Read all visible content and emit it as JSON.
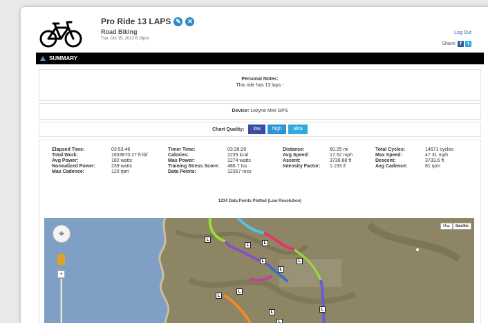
{
  "ride": {
    "title": "Pro Ride 13 LAPS",
    "type": "Road Biking",
    "date": "Tue, Oct 15, 2013 6:16pm"
  },
  "header": {
    "logout": "Log Out",
    "share": "Share:"
  },
  "summary": {
    "label": "SUMMARY"
  },
  "notes": {
    "label": "Personal Notes:",
    "text": "This ride has 13 laps -"
  },
  "device": {
    "label": "Device:",
    "value": "Lezyne Mini GPS"
  },
  "chart_quality": {
    "label": "Chart Quality:",
    "options": [
      "low",
      "high",
      "ultra"
    ],
    "selected": "low"
  },
  "stats": [
    [
      "Elapsed Time:",
      "03:53:46",
      "Timer Time:",
      "03:26:20",
      "Distance:",
      "60.25 mi",
      "Total Cycles:",
      "14671 cycles"
    ],
    [
      "Total Work:",
      "1653870.27 ft-lbf",
      "Calories:",
      "2235 kcal",
      "Avg Speed:",
      "17.52 mph",
      "Max Speed:",
      "47.31 mph"
    ],
    [
      "Avg Power:",
      "182 watts",
      "Max Power:",
      "1274 watts",
      "Ascent:",
      "3736.88 ft",
      "Descent:",
      "3733.6 ft"
    ],
    [
      "Normalized Power:",
      "239 watts",
      "Training Stress Score:",
      "486.7 tss",
      "Intensity Factor:",
      "1.193 if",
      "Avg Cadence:",
      "81 rpm"
    ],
    [
      "Max Cadence:",
      "120 rpm",
      "Data Points:",
      "12357 recs",
      "",
      "",
      "",
      ""
    ]
  ],
  "plotted_text": "1234 Data Points Plotted (Low Resolution)",
  "map": {
    "types": [
      "Map",
      "Satellite"
    ],
    "selected_type": "Satellite",
    "lap_marker": "L",
    "zoom_in": "+"
  },
  "colors": {
    "header_bar": "#000000",
    "accent_blue": "#2f87c9",
    "quality_low": "#3b4ca8",
    "quality_high": "#2c96d4",
    "quality_ultra": "#31a9dc",
    "ocean": "#7f9fc4",
    "land": "#8d8563"
  },
  "icons": [
    "bike-icon",
    "edit-icon",
    "delete-icon",
    "facebook-icon",
    "twitter-icon",
    "triangle-up-icon",
    "pan-control-icon",
    "pegman-icon"
  ]
}
